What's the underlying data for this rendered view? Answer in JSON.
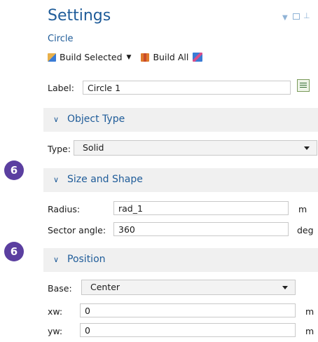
{
  "header": {
    "title": "Settings",
    "subtitle": "Circle"
  },
  "toolbar": {
    "build_selected": "Build Selected",
    "build_all": "Build All"
  },
  "label_row": {
    "label": "Label:",
    "value": "Circle 1"
  },
  "sections": {
    "object_type": {
      "title": "Object Type",
      "type_label": "Type:",
      "type_value": "Solid"
    },
    "size_shape": {
      "title": "Size and Shape",
      "badge": "6",
      "radius_label": "Radius:",
      "radius_value": "rad_1",
      "radius_unit": "m",
      "sector_label": "Sector angle:",
      "sector_value": "360",
      "sector_unit": "deg"
    },
    "position": {
      "title": "Position",
      "badge": "6",
      "base_label": "Base:",
      "base_value": "Center",
      "xw_label": "xw:",
      "xw_value": "0",
      "xw_unit": "m",
      "yw_label": "yw:",
      "yw_value": "0",
      "yw_unit": "m"
    }
  },
  "colors": {
    "accent": "#1f5c99",
    "badge": "#5b3fa0",
    "section_bg": "#f0f0f0"
  }
}
